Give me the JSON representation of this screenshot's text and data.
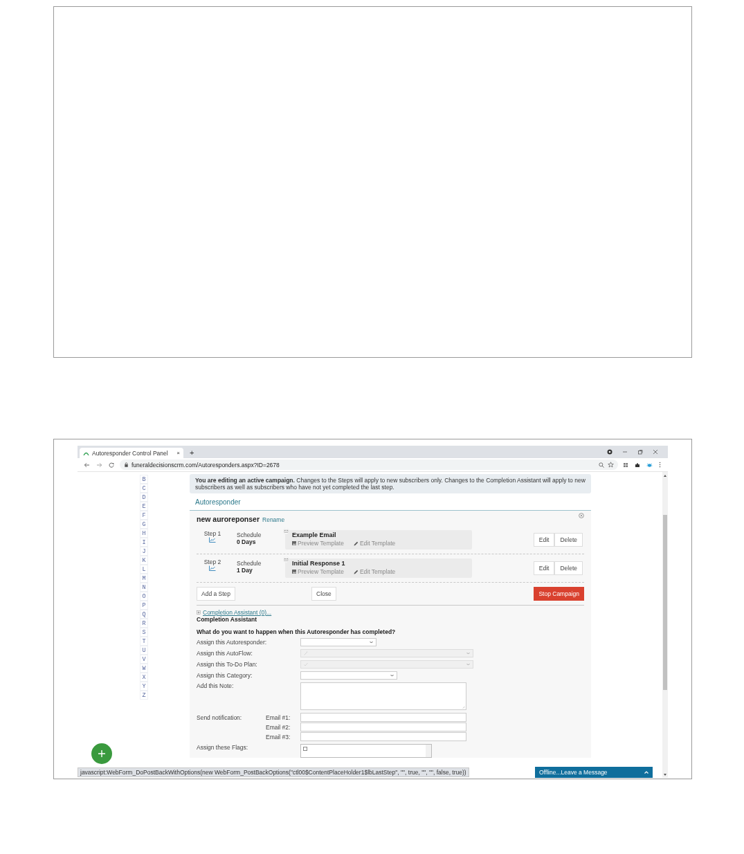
{
  "browser": {
    "tab": {
      "title": "Autoresponder Control Panel",
      "close": "×"
    },
    "new_tab": "+",
    "url": "funeraldecisionscrm.com/Autoresponders.aspx?ID=2678"
  },
  "alphabet": [
    "B",
    "C",
    "D",
    "E",
    "F",
    "G",
    "H",
    "I",
    "J",
    "K",
    "L",
    "M",
    "N",
    "O",
    "P",
    "Q",
    "R",
    "S",
    "T",
    "U",
    "V",
    "W",
    "X",
    "Y",
    "Z"
  ],
  "notice": "**You are editing an active campaign.** Changes to the Steps will apply to new subscribers only. Changes to the Completion Assistant will apply to new subscribers as well as subscribers who have not yet completed the last step.",
  "section_title": "Autoresponder",
  "campaign": {
    "name": "new auroreponser",
    "rename": "Rename"
  },
  "steps": [
    {
      "label": "Step 1",
      "schedule_label": "Schedule",
      "schedule": "0 Days",
      "template": "Example Email",
      "preview": "Preview Template",
      "edit_template": "Edit Template",
      "buttons": [
        "Edit",
        "Delete"
      ]
    },
    {
      "label": "Step 2",
      "schedule_label": "Schedule",
      "schedule": "1 Day",
      "template": "Initial Response 1",
      "preview": "Preview Template",
      "edit_template": "Edit Template",
      "buttons": [
        "Edit",
        "Delete"
      ]
    }
  ],
  "actions": [
    {
      "label": "Add a Step",
      "kind": "default"
    },
    {
      "label": "Close",
      "kind": "default"
    },
    {
      "label": "Stop Campaign",
      "kind": "danger"
    }
  ],
  "completion": {
    "link": "Completion Assistant (0)...",
    "heading": "Completion Assistant",
    "question": "What do you want to happen when this Autoresponder has completed?"
  },
  "form": [
    {
      "label": "Assign this Autoresponder:",
      "disabled": false
    },
    {
      "label": "Assign this AutoFlow:",
      "disabled": true
    },
    {
      "label": "Assign this To-Do Plan:",
      "disabled": true
    },
    {
      "label": "Assign this Category:",
      "disabled": false
    }
  ],
  "note": {
    "label": "Add this Note:"
  },
  "notification": {
    "label": "Send notification:",
    "emails": [
      "Email #1:",
      "Email #2:",
      "Email #3:"
    ]
  },
  "flags": {
    "label": "Assign these Flags:"
  },
  "status_bar": "javascript:WebForm_DoPostBackWithOptions(new WebForm_PostBackOptions(\"ctl00$ContentPlaceHolder1$lbLastStep\", \"\", true, \"\", \"\", false, true))",
  "chat": {
    "label": "Offline...Leave a Message"
  }
}
